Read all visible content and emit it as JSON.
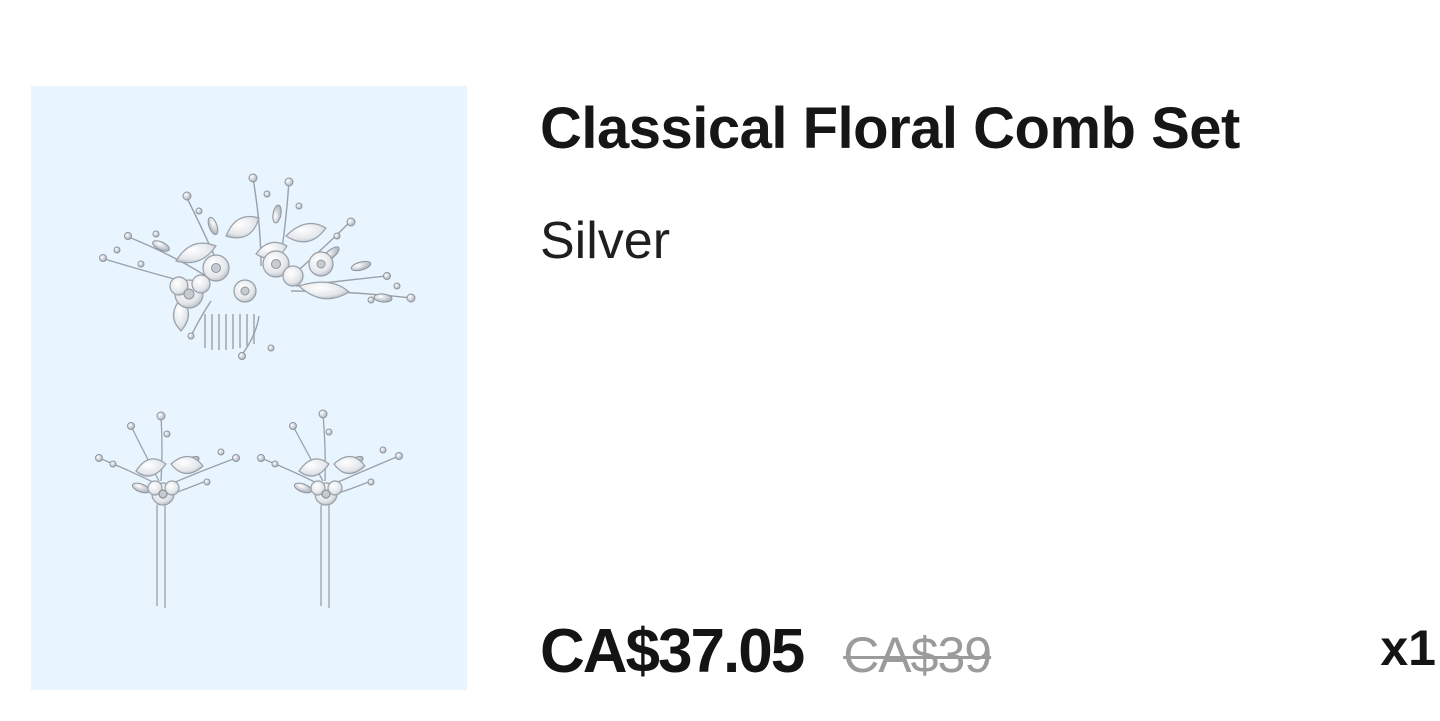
{
  "product": {
    "title": "Classical Floral Comb Set",
    "variant": "Silver",
    "price_current": "CA$37.05",
    "price_original": "CA$39",
    "quantity": "x1",
    "image_alt": "silver floral hair comb and two hair pins"
  },
  "colors": {
    "image_background": "#e8f5fe",
    "price_strike": "#9b9b9b",
    "text": "#161616"
  }
}
